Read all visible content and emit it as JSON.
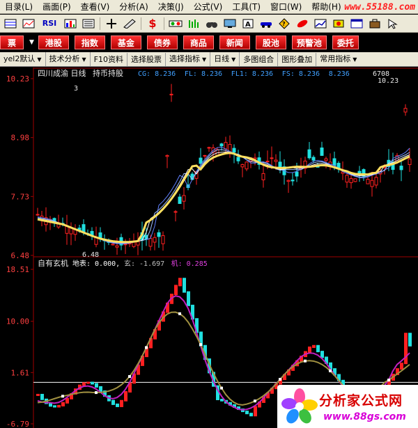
{
  "menu": {
    "items": [
      "目录(L)",
      "画面(P)",
      "查看(V)",
      "分析(A)",
      "决策(J)",
      "公式(V)",
      "工具(T)",
      "窗口(W)",
      "帮助(H)"
    ],
    "site_logo": "www.55188.com"
  },
  "toolbar": {
    "rsi_label": "RSI",
    "money_label": "$"
  },
  "quicknav": {
    "items": [
      "票",
      "港股",
      "指数",
      "基金",
      "债券",
      "商品",
      "新闻",
      "股池",
      "预警池",
      "委托"
    ]
  },
  "funcbar": {
    "items": [
      "yel2默认",
      "技术分析",
      "F10资料",
      "选择股票",
      "选择指标",
      "日线",
      "多图组合",
      "图形叠加",
      "常用指标"
    ]
  },
  "price_panel": {
    "stock_name": "四川成渝",
    "period": "日线",
    "indicator_name": "持币持股",
    "readouts": [
      {
        "label": "CG: 8.236",
        "color": "#40a0ff"
      },
      {
        "label": "FL: 8.236",
        "color": "#40a0ff"
      },
      {
        "label": "FL1: 8.236",
        "color": "#40a0ff"
      },
      {
        "label": "FS: 8.236",
        "color": "#40a0ff"
      },
      {
        "label": "8.236",
        "color": "#40a0ff"
      }
    ],
    "volume_label": "6708",
    "high_label": "10.23",
    "low_label": "6.48",
    "marker_label": "3",
    "y_ticks": [
      "10.23",
      "8.98",
      "7.73",
      "6.48"
    ],
    "y_values": [
      10.23,
      8.98,
      7.73,
      6.48
    ]
  },
  "indicator_panel": {
    "title": "自有玄机",
    "readouts": [
      {
        "label": "地表: 0.000,",
        "color": "#ffffff"
      },
      {
        "label": "玄: -1.697",
        "color": "#c0c0c0"
      },
      {
        "label": "机: 0.285",
        "color": "#e040e0"
      }
    ],
    "y_ticks": [
      "18.51",
      "10.00",
      "1.61",
      "-6.79"
    ],
    "y_values": [
      18.51,
      10.0,
      1.61,
      -6.79
    ]
  },
  "colors": {
    "up": "#ff2020",
    "down": "#20e0e0",
    "axis": "#a00000",
    "tick_label": "#ff4040"
  },
  "logo": {
    "title": "分析家公式网",
    "url": "www.88gs.com"
  }
}
